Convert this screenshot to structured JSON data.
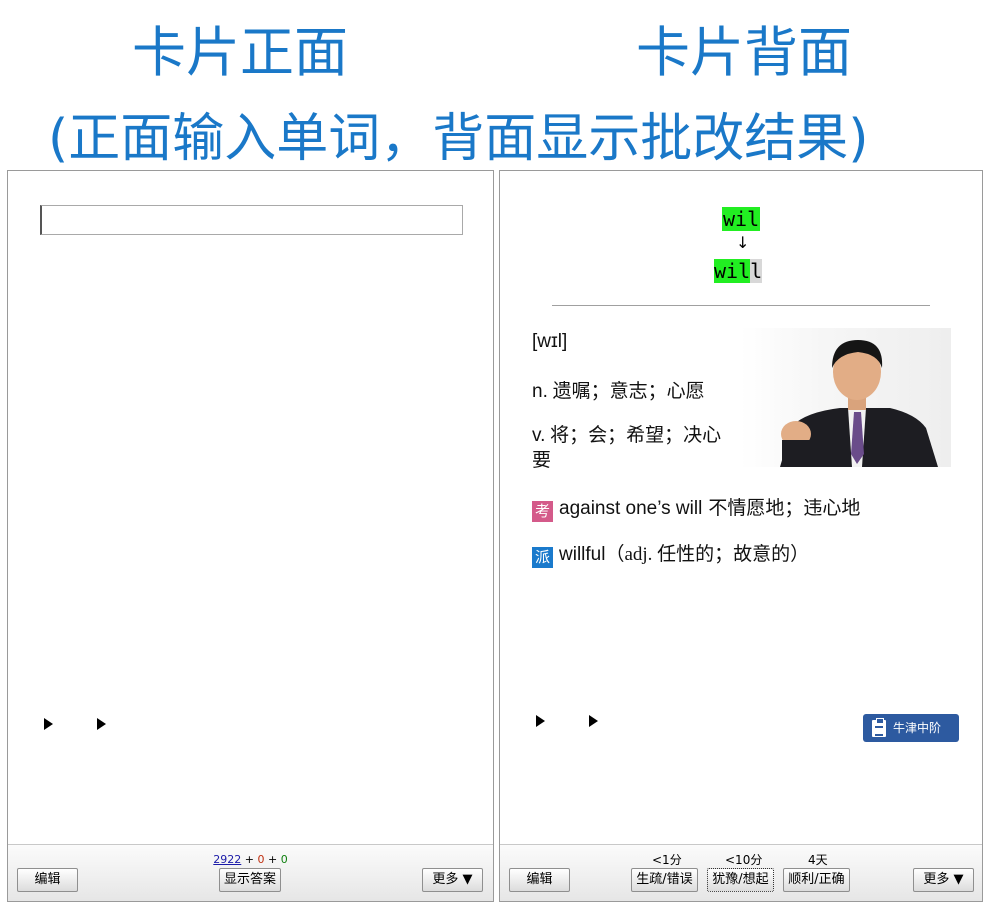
{
  "headings": {
    "front": "卡片正面",
    "back": "卡片背面",
    "subtitle": "(正面输入单词，背面显示批改结果)"
  },
  "front_card": {
    "input_value": "",
    "counts": {
      "new": "2922",
      "sep1": "+",
      "learning": "0",
      "sep2": "+",
      "review": "0"
    },
    "colors": {
      "new": "#1a1aa8",
      "learning": "#c03010",
      "review": "#108010"
    },
    "toolbar": {
      "edit_label": "编辑",
      "show_answer_label": "显示答案",
      "more_label": "更多 ▼"
    }
  },
  "back_card": {
    "typed_word": "wil",
    "arrow": "↓",
    "correct_prefix": "wil",
    "correct_missing": "l",
    "phonetic": "[wɪl]",
    "definitions": [
      {
        "pos": "n.",
        "text": "遗嘱；意志；心愿"
      },
      {
        "pos": "v.",
        "text": "将；会；希望；决心要"
      }
    ],
    "phrases": [
      {
        "tag": "考",
        "english": "against one’s will",
        "chinese": "不情愿地；违心地"
      },
      {
        "tag": "派",
        "english": "willful",
        "chinese": "（adj. 任性的；故意的）"
      }
    ],
    "tag_colors": {
      "kao": "#d45a8a",
      "pai": "#1a7acc"
    },
    "dictionary_badge": "牛津中阶",
    "badge_color": "#2d5aa0",
    "highlight_color": "#22ee22",
    "toolbar": {
      "edit_label": "编辑",
      "more_label": "更多 ▼",
      "answers": [
        {
          "interval": "<1分",
          "label": "生疏/错误"
        },
        {
          "interval": "<10分",
          "label": "犹豫/想起"
        },
        {
          "interval": "4天",
          "label": "顺利/正确"
        }
      ]
    }
  }
}
